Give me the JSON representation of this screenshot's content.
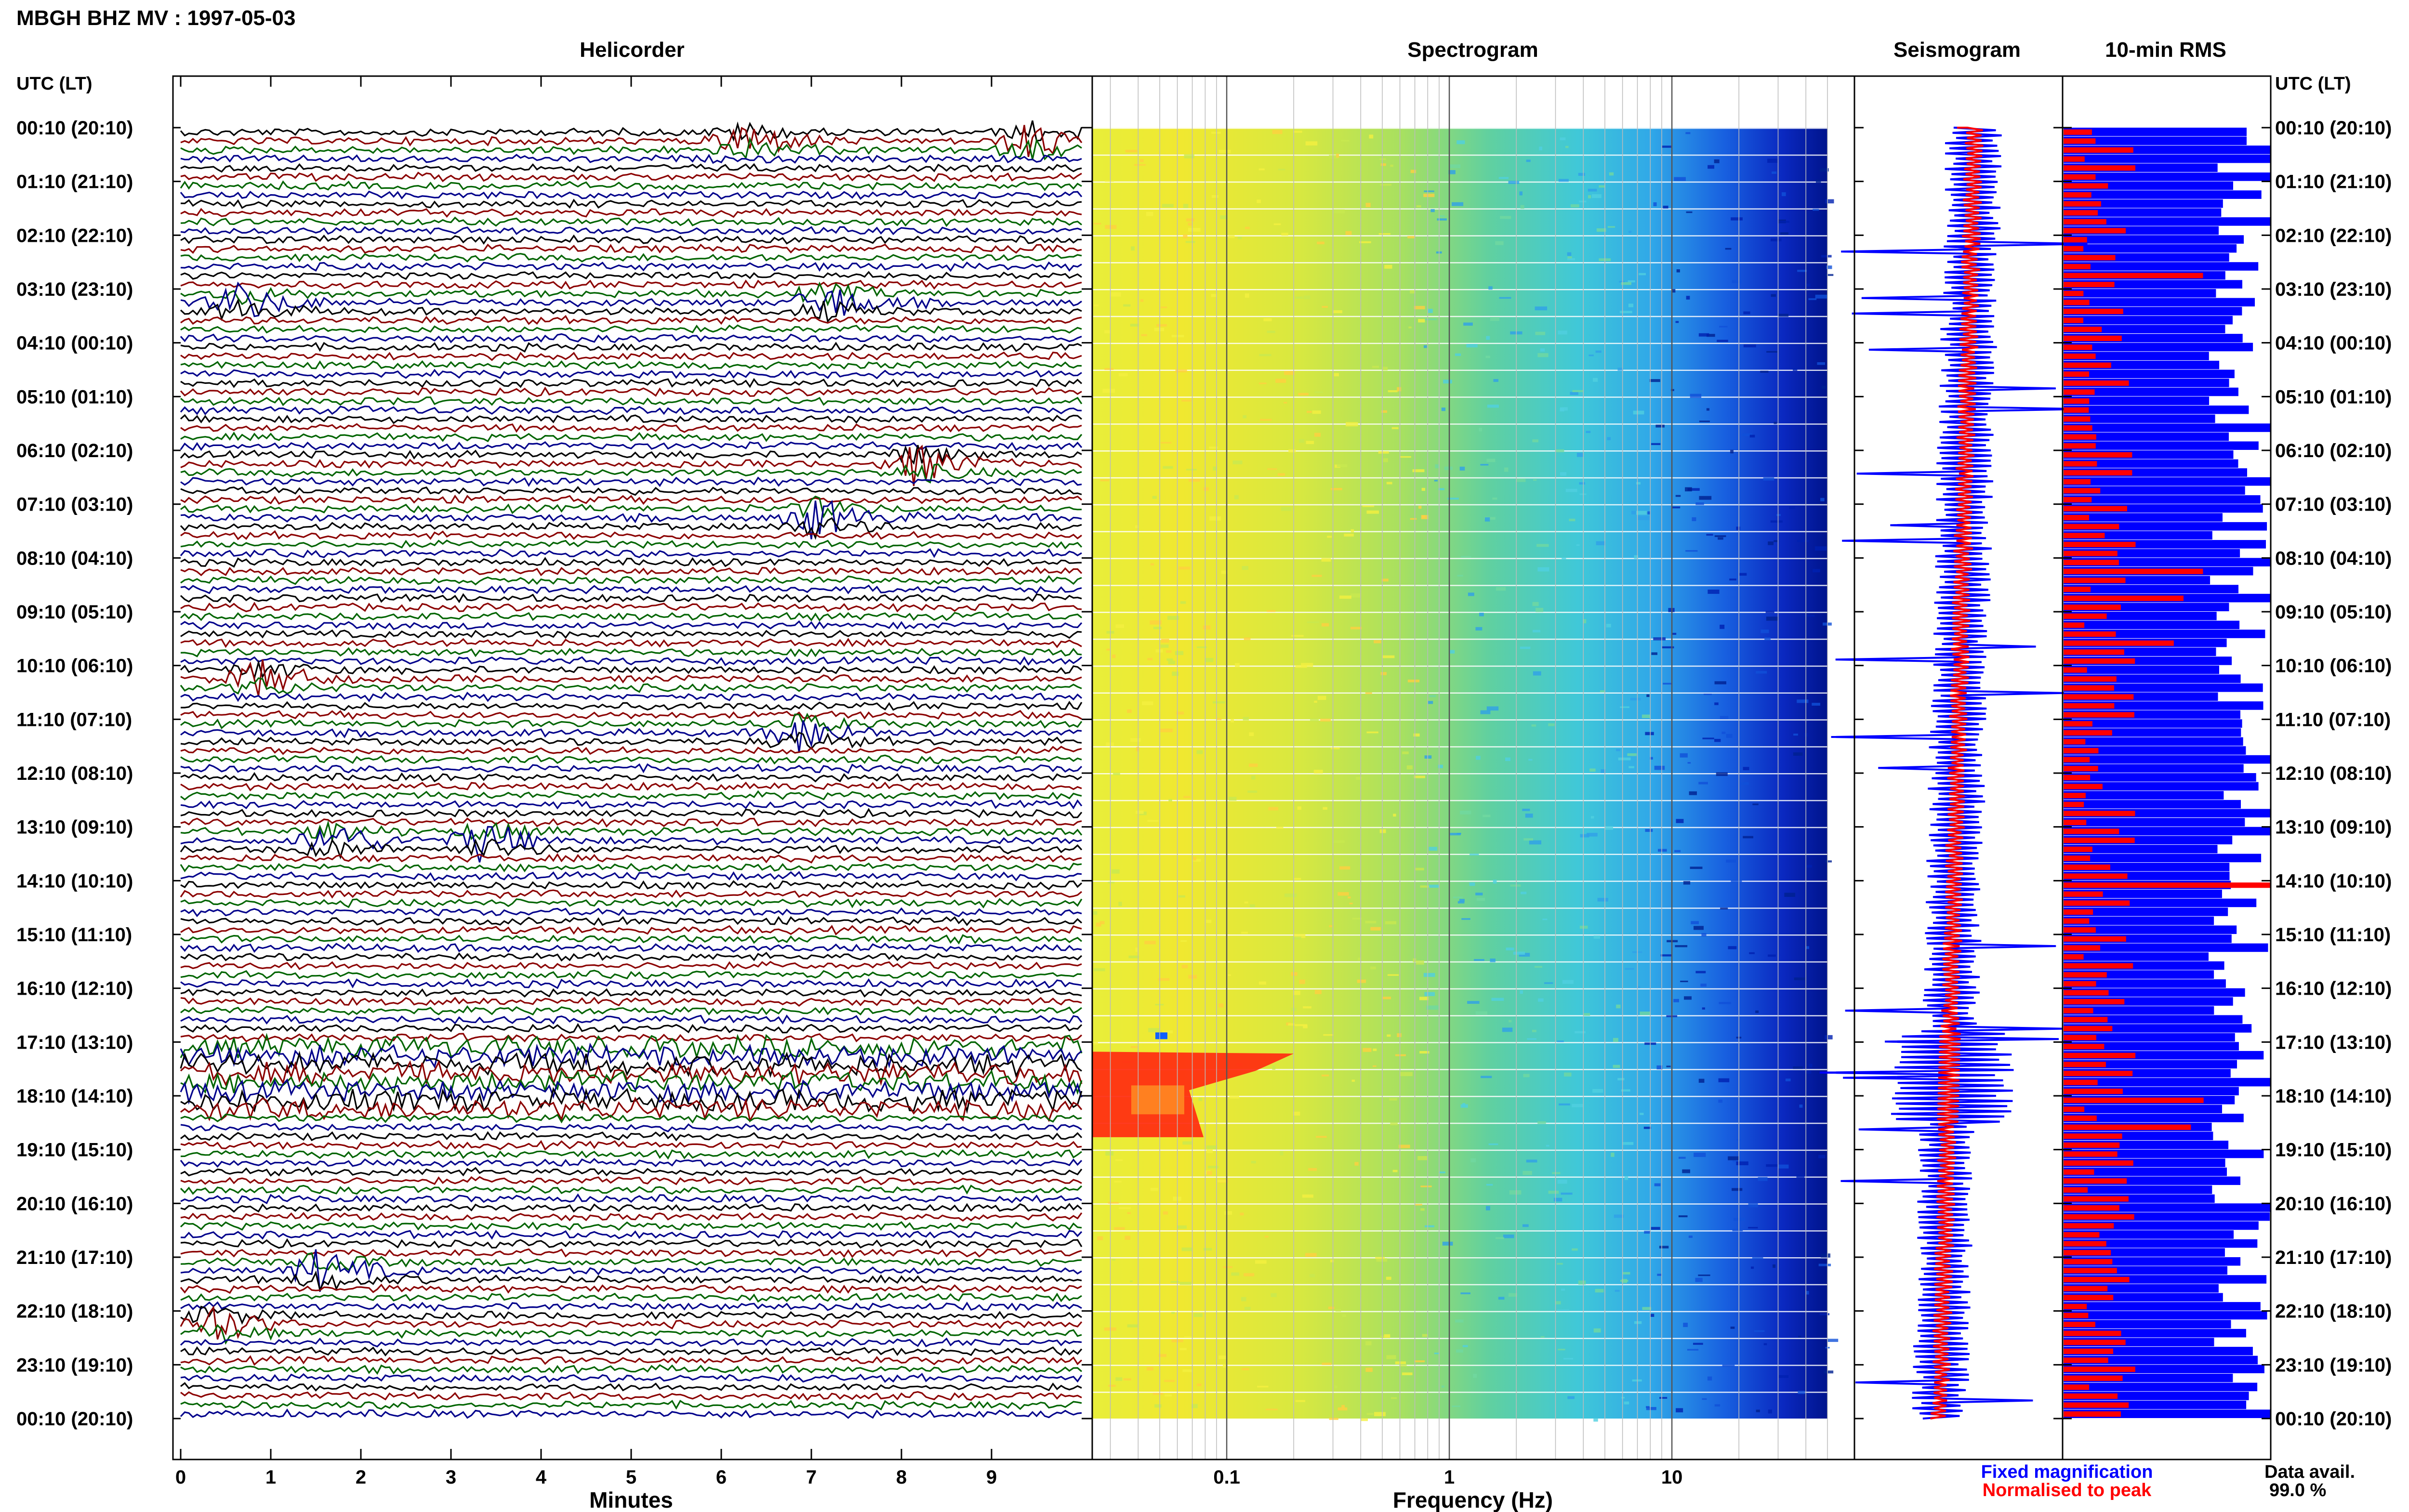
{
  "station_title": "MBGH BHZ MV : 1997-05-03",
  "panels": {
    "helicorder": "Helicorder",
    "spectrogram": "Spectrogram",
    "seismogram": "Seismogram",
    "rms": "10-min RMS"
  },
  "time_axis": {
    "header": "UTC (LT)",
    "labels": [
      "00:10 (20:10)",
      "01:10 (21:10)",
      "02:10 (22:10)",
      "03:10 (23:10)",
      "04:10 (00:10)",
      "05:10 (01:10)",
      "06:10 (02:10)",
      "07:10 (03:10)",
      "08:10 (04:10)",
      "09:10 (05:10)",
      "10:10 (06:10)",
      "11:10 (07:10)",
      "12:10 (08:10)",
      "13:10 (09:10)",
      "14:10 (10:10)",
      "15:10 (11:10)",
      "16:10 (12:10)",
      "17:10 (13:10)",
      "18:10 (14:10)",
      "19:10 (15:10)",
      "20:10 (16:10)",
      "21:10 (17:10)",
      "22:10 (18:10)",
      "23:10 (19:10)",
      "00:10 (20:10)"
    ]
  },
  "x_axes": {
    "minutes_label": "Minutes",
    "minutes_ticks": [
      "0",
      "1",
      "2",
      "3",
      "4",
      "5",
      "6",
      "7",
      "8",
      "9"
    ],
    "frequency_label": "Frequency (Hz)",
    "frequency_ticks": [
      "0.1",
      "1",
      "10"
    ]
  },
  "legend": {
    "fixed": "Fixed magnification",
    "normalised": "Normalised to peak",
    "fixed_color": "#0000ff",
    "normalised_color": "#ff0000"
  },
  "data_availability": {
    "label": "Data avail.",
    "value": "99.0 %"
  },
  "colors": {
    "trace_cycle": [
      "#000000",
      "#8b0000",
      "#006400",
      "#00008b"
    ],
    "rms_fixed": "#0000ff",
    "rms_normalised": "#ff0000"
  },
  "chart_data": {
    "type": "heatmap",
    "rows": 144,
    "helicorder": {
      "x_range_minutes": [
        0,
        10
      ],
      "trace_colors": [
        "black",
        "dark red",
        "dark green",
        "dark blue"
      ],
      "notable_events_hour_minute": [
        [
          0,
          9.4
        ],
        [
          0,
          6.2
        ],
        [
          3,
          0.6
        ],
        [
          3,
          7.1
        ],
        [
          6,
          8.1
        ],
        [
          7,
          7.0
        ],
        [
          10,
          0.8
        ],
        [
          11,
          6.8
        ],
        [
          13,
          1.6
        ],
        [
          13,
          3.3
        ],
        [
          21,
          1.5
        ],
        [
          22,
          0.3
        ]
      ],
      "tremor_band_hours": [
        17,
        18
      ]
    },
    "spectrogram": {
      "x_scale": "log",
      "x_range_hz": [
        0.025,
        50
      ],
      "low_freq_anomaly_hours": [
        17,
        18.5
      ],
      "low_freq_anomaly_hz": [
        0.025,
        0.2
      ]
    },
    "rms": {
      "fixed_scale": "blue",
      "normalised_scale": "red",
      "peak_normalised_hour": 14
    }
  }
}
